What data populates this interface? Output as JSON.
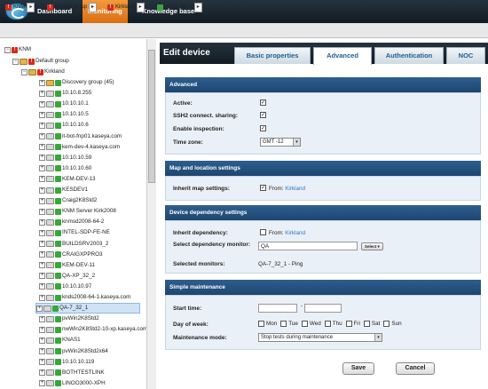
{
  "nav": {
    "dashboard": "Dashboard",
    "monitoring": "Monitoring",
    "knowledge_base": "Knowledge base"
  },
  "breadcrumb": [
    {
      "label": "KNM",
      "icon": "red-alert-icon"
    },
    {
      "label": "Default group",
      "icon": "red-alert-icon"
    },
    {
      "label": "Kirkland",
      "icon": "red-alert-icon"
    },
    {
      "label": "QA-7_32_1",
      "icon": "green-status-icon"
    }
  ],
  "tree": {
    "root": "KNM",
    "default_group": "Default group",
    "kirkland": "Kirkland",
    "items": [
      "Discovery group (45)",
      "10.10.8.255",
      "10.10.10.1",
      "10.10.10.5",
      "10.10.10.6",
      "it-bot-fnp01.kaseya.com",
      "kem-dev-4.kaseya.com",
      "10.10.10.59",
      "10.10.10.60",
      "KEM-DEV-13",
      "KESDEV1",
      "Craig2K8Std2",
      "KNM Server Kirk2008",
      "knmsd2008-64-2",
      "INTEL-SDP-FE-NE",
      "BUILDSRV2003_2",
      "CRAIGXPPRO3",
      "KEM-DEV-11",
      "QA-XP_32_2",
      "10.10.10.97",
      "knds2008-64-1.kaseya.com",
      "QA-7_32_1",
      "pvWin2K8Std2",
      "nwWin2K8Std2-10-xp.kaseya.com",
      "KNAS1",
      "pvWin2K8Std2x64",
      "10.10.10.119",
      "BOTHTESTLINK",
      "LINOO3000-XPH"
    ],
    "selected": "QA-7_32_1"
  },
  "panel": {
    "title": "Edit device",
    "tabs": [
      "Basic properties",
      "Advanced",
      "Authentication",
      "NOC"
    ],
    "active_tab": "Advanced"
  },
  "advanced": {
    "heading": "Advanced",
    "active_label": "Active:",
    "active_checked": true,
    "ssh_label": "SSH2 connect. sharing:",
    "ssh_checked": true,
    "inspection_label": "Enable inspection:",
    "inspection_checked": true,
    "timezone_label": "Time zone:",
    "timezone_value": "GMT -12"
  },
  "map": {
    "heading": "Map and location settings",
    "inherit_label": "Inherit map settings:",
    "from_label": "From:",
    "from_value": "Kirkland",
    "checked": true
  },
  "dependency": {
    "heading": "Device dependency settings",
    "inherit_label": "Inherit dependency:",
    "from_label": "From:",
    "from_value": "Kirkland",
    "checked": false,
    "select_label": "Select dependency monitor:",
    "select_value": "QA",
    "select_button": "Select",
    "selected_label": "Selected monitors:",
    "selected_value": "QA-7_32_1 - Ping"
  },
  "maintenance": {
    "heading": "Simple maintenance",
    "start_label": "Start time:",
    "start_sep": "-",
    "start_value": "",
    "end_value": "",
    "dow_label": "Day of week:",
    "days": [
      "Mon",
      "Tue",
      "Wed",
      "Thu",
      "Fri",
      "Sat",
      "Sun"
    ],
    "mode_label": "Maintenance mode:",
    "mode_value": "Stop tests during maintenance"
  },
  "buttons": {
    "save": "Save",
    "cancel": "Cancel"
  },
  "colors": {
    "accent": "#e4801f",
    "header": "#1d4670",
    "link": "#2a78c2"
  }
}
